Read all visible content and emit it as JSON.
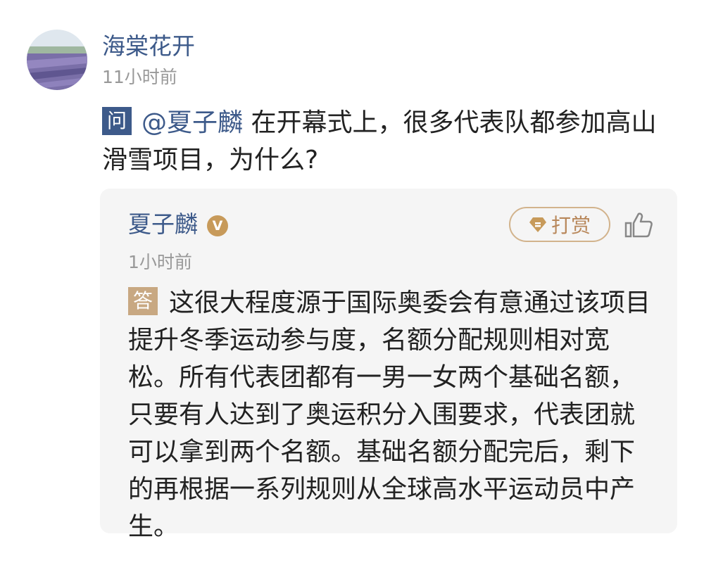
{
  "post": {
    "author": "海棠花开",
    "time": "11小时前"
  },
  "question": {
    "badge": "问",
    "mention": "@夏子麟",
    "text": "在开幕式上，很多代表队都参加高山滑雪项目，为什么?"
  },
  "answer": {
    "author": "夏子麟",
    "verified_mark": "V",
    "tip_label": "打赏",
    "time": "1小时前",
    "badge": "答",
    "text": "这很大程度源于国际奥委会有意通过该项目提升冬季运动参与度，名额分配规则相对宽松。所有代表团都有一男一女两个基础名额，只要有人达到了奥运积分入围要求，代表团就可以拿到两个名额。基础名额分配完后，剩下的再根据一系列规则从全球高水平运动员中产生。"
  },
  "colors": {
    "name_blue": "#3d5a8a",
    "question_badge": "#3d5a8a",
    "answer_badge": "#c8a882",
    "tip_gold": "#b8875a",
    "card_background": "#f5f5f5",
    "muted_text": "#999999"
  },
  "icons": {
    "avatar": "lavender-field-avatar",
    "verified": "verified-badge-icon",
    "tip": "gem-icon",
    "like": "thumbs-up-icon"
  }
}
